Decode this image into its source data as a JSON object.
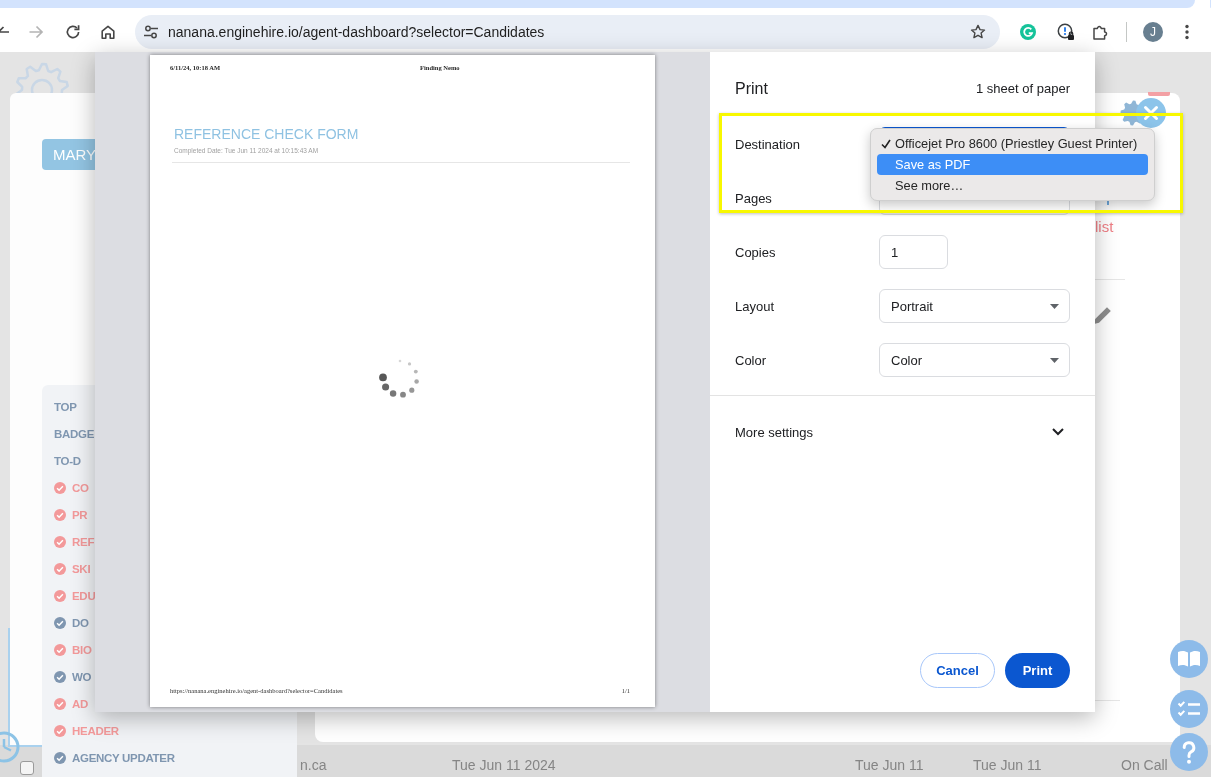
{
  "browser": {
    "forward_disabled": true,
    "url": "nanana.enginehire.io/agent-dashboard?selector=Candidates",
    "profile_initial": "J"
  },
  "background_page": {
    "user_button": "MARY",
    "sidebar": {
      "items": [
        {
          "kind": "heading",
          "label": "TOP"
        },
        {
          "kind": "heading",
          "label": "BADGE"
        },
        {
          "kind": "heading",
          "label": "TO-D"
        },
        {
          "kind": "task",
          "label": "CO",
          "color": "#f3999a"
        },
        {
          "kind": "task",
          "label": "PR",
          "color": "#f3999a"
        },
        {
          "kind": "task",
          "label": "REF",
          "color": "#f3999a"
        },
        {
          "kind": "task",
          "label": "SKI",
          "color": "#f3999a"
        },
        {
          "kind": "task",
          "label": "EDU",
          "color": "#f3999a"
        },
        {
          "kind": "task",
          "label": "DO",
          "color": "#7f96b0"
        },
        {
          "kind": "task",
          "label": "BIO",
          "color": "#f3999a"
        },
        {
          "kind": "task",
          "label": "WO",
          "color": "#7f96b0"
        },
        {
          "kind": "task",
          "label": "AD",
          "color": "#f3999a"
        },
        {
          "kind": "task",
          "label": "HEADER",
          "color": "#f3999a"
        },
        {
          "kind": "task",
          "label": "AGENCY UPDATER",
          "color": "#7f96b0"
        }
      ]
    },
    "side_panel": {
      "link": "list"
    },
    "table_row": {
      "checked": false,
      "cells": [
        "n.ca",
        "Tue Jun 11 2024",
        "Tue Jun 11",
        "Tue Jun 11",
        "On Call"
      ]
    }
  },
  "print_dialog": {
    "preview": {
      "header_date": "6/11/24, 10:18 AM",
      "header_title": "Finding Nemo",
      "form_title": "REFERENCE CHECK FORM",
      "completed_date": "Completed Date: Tue Jun 11 2024 at 10:15:43 AM",
      "loading": true,
      "footer_url": "https://nanana.enginehire.io/agent-dashboard?selector=Candidates",
      "page_number": "1/1"
    },
    "title": "Print",
    "sheet_count": "1 sheet of paper",
    "settings": [
      {
        "kind": "select",
        "label": "Destination",
        "focused": true
      },
      {
        "kind": "select",
        "label": "Pages",
        "focused": false
      },
      {
        "kind": "input",
        "label": "Copies",
        "value": "1",
        "focused": false
      },
      {
        "kind": "select",
        "label": "Layout",
        "value": "Portrait",
        "focused": false
      },
      {
        "kind": "select",
        "label": "Color",
        "value": "Color",
        "focused": false
      }
    ],
    "more_settings": {
      "label": "More settings",
      "expanded": false
    },
    "buttons": [
      {
        "kind": "cancel",
        "label": "Cancel"
      },
      {
        "kind": "confirm",
        "label": "Print"
      }
    ],
    "destination_menu": {
      "items": [
        {
          "label": "Officejet Pro 8600 (Priestley Guest Printer)",
          "selected": true,
          "highlighted": false
        },
        {
          "label": "Save as PDF",
          "selected": false,
          "highlighted": true
        },
        {
          "label": "See more…",
          "selected": false,
          "highlighted": false
        }
      ]
    }
  }
}
